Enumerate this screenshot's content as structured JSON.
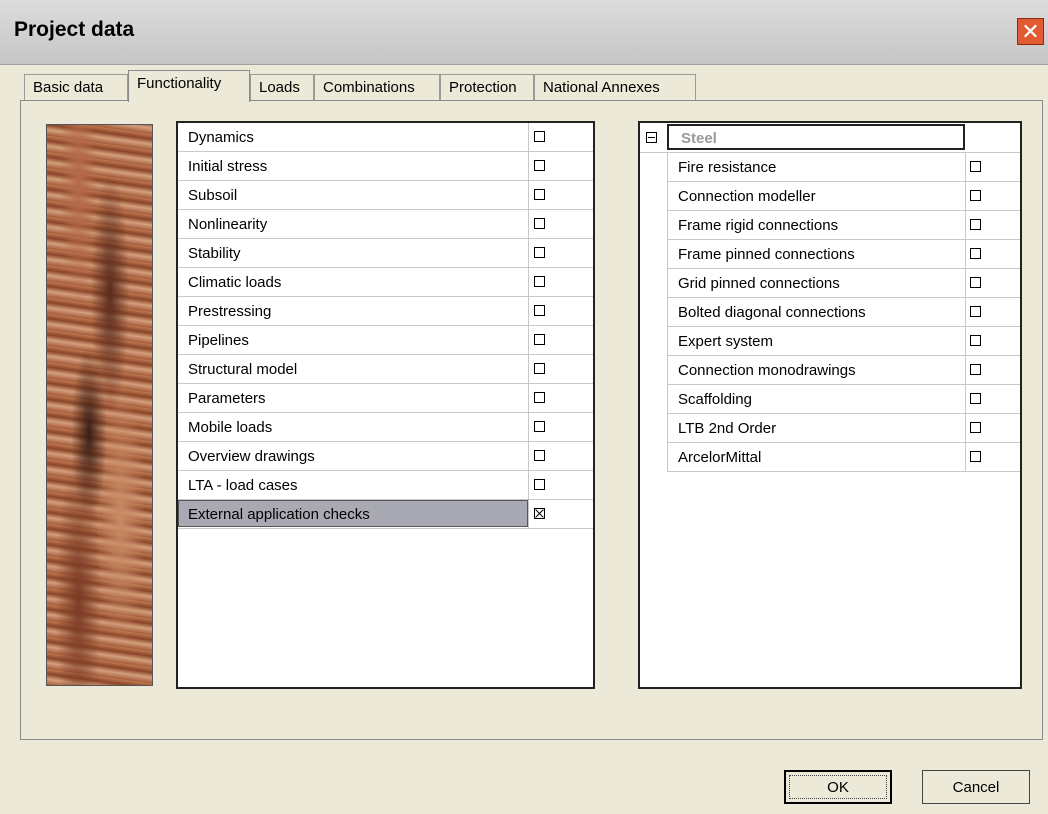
{
  "window": {
    "title": "Project data"
  },
  "tabs": [
    {
      "label": "Basic data"
    },
    {
      "label": "Functionality"
    },
    {
      "label": "Loads"
    },
    {
      "label": "Combinations"
    },
    {
      "label": "Protection"
    },
    {
      "label": "National Annexes"
    }
  ],
  "functions": [
    {
      "label": "Dynamics",
      "checked": false
    },
    {
      "label": "Initial stress",
      "checked": false
    },
    {
      "label": "Subsoil",
      "checked": false
    },
    {
      "label": "Nonlinearity",
      "checked": false
    },
    {
      "label": "Stability",
      "checked": false
    },
    {
      "label": "Climatic loads",
      "checked": false
    },
    {
      "label": "Prestressing",
      "checked": false
    },
    {
      "label": "Pipelines",
      "checked": false
    },
    {
      "label": "Structural model",
      "checked": false
    },
    {
      "label": "Parameters",
      "checked": false
    },
    {
      "label": "Mobile loads",
      "checked": false
    },
    {
      "label": "Overview drawings",
      "checked": false
    },
    {
      "label": "LTA - load cases",
      "checked": false
    },
    {
      "label": "External application checks",
      "checked": true
    }
  ],
  "steel": {
    "group_label": "Steel",
    "items": [
      {
        "label": "Fire resistance",
        "checked": false
      },
      {
        "label": "Connection modeller",
        "checked": false
      },
      {
        "label": "Frame rigid connections",
        "checked": false
      },
      {
        "label": "Frame pinned connections",
        "checked": false
      },
      {
        "label": "Grid pinned connections",
        "checked": false
      },
      {
        "label": "Bolted diagonal connections",
        "checked": false
      },
      {
        "label": "Expert system",
        "checked": false
      },
      {
        "label": "Connection monodrawings",
        "checked": false
      },
      {
        "label": "Scaffolding",
        "checked": false
      },
      {
        "label": "LTB 2nd Order",
        "checked": false
      },
      {
        "label": "ArcelorMittal",
        "checked": false
      }
    ]
  },
  "buttons": {
    "ok": "OK",
    "cancel": "Cancel"
  }
}
